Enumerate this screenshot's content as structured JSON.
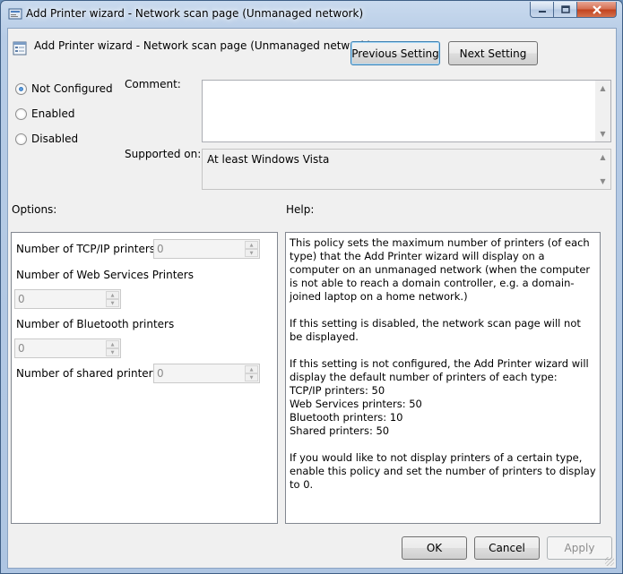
{
  "window": {
    "title": "Add Printer wizard - Network scan page (Unmanaged network)"
  },
  "header": {
    "title": "Add Printer wizard - Network scan page (Unmanaged network)",
    "previous_label": "Previous Setting",
    "next_label": "Next Setting"
  },
  "state": {
    "options": [
      {
        "label": "Not Configured",
        "selected": true
      },
      {
        "label": "Enabled",
        "selected": false
      },
      {
        "label": "Disabled",
        "selected": false
      }
    ]
  },
  "comment": {
    "label": "Comment:",
    "value": ""
  },
  "supported": {
    "label": "Supported on:",
    "value": "At least Windows Vista"
  },
  "sections": {
    "options_label": "Options:",
    "help_label": "Help:"
  },
  "options": {
    "tcpip": {
      "label": "Number of TCP/IP printers",
      "value": "0"
    },
    "web_services": {
      "label": "Number of Web Services Printers",
      "value": "0"
    },
    "bluetooth": {
      "label": "Number of Bluetooth printers",
      "value": "0"
    },
    "shared": {
      "label": "Number of shared printers",
      "value": "0"
    }
  },
  "help": {
    "p1": "This policy sets the maximum number of printers (of each type) that the Add Printer wizard will display on a computer on an unmanaged network (when the computer is not able to reach a domain controller, e.g. a domain-joined laptop on a home network.)",
    "p2": "If this setting is disabled, the network scan page will not be displayed.",
    "p3": "If this setting is not configured, the Add Printer wizard will display the default number of printers of each type:",
    "l1": "TCP/IP printers: 50",
    "l2": "Web Services printers: 50",
    "l3": "Bluetooth printers: 10",
    "l4": "Shared printers: 50",
    "p4": "If you would like to not display printers of a certain type, enable this policy and set the number of printers to display to 0."
  },
  "footer": {
    "ok_label": "OK",
    "cancel_label": "Cancel",
    "apply_label": "Apply"
  },
  "colors": {
    "title_bar": "#b7cce6",
    "client_bg": "#f0f0f0",
    "default_border": "#3c7fb1"
  }
}
